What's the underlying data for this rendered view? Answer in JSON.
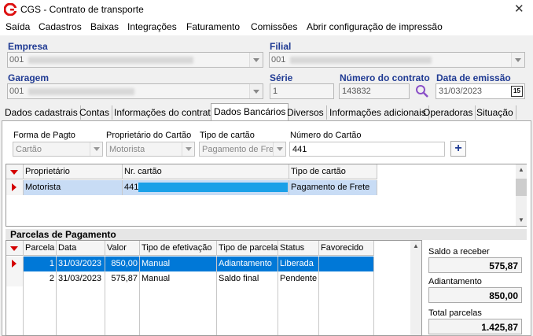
{
  "window": {
    "title": "CGS - Contrato de transporte",
    "close_label": "✕"
  },
  "menu": [
    "Saída",
    "Cadastros",
    "Baixas",
    "Integrações",
    "Faturamento",
    "Comissões",
    "Abrir configuração de impressão"
  ],
  "header": {
    "empresa_label": "Empresa",
    "empresa_value": "001",
    "filial_label": "Filial",
    "filial_value": "001",
    "garagem_label": "Garagem",
    "garagem_value": "001",
    "serie_label": "Série",
    "serie_value": "1",
    "numero_label": "Número do contrato",
    "numero_value": "143832",
    "data_label": "Data de emissão",
    "data_value": "31/03/2023",
    "calendar_label": "15"
  },
  "tabs": [
    "Dados cadastrais",
    "Contas",
    "Informações do contrato",
    "Dados Bancários",
    "Diversos",
    "Informações adicionais",
    "Operadoras",
    "Situação"
  ],
  "active_tab": "Dados Bancários",
  "bank": {
    "forma_label": "Forma de Pagto",
    "forma_value": "Cartão",
    "prop_label": "Proprietário do Cartão",
    "prop_value": "Motorista",
    "tipo_label": "Tipo de cartão",
    "tipo_value": "Pagamento de Fre",
    "num_label": "Número do Cartão",
    "num_value": "441",
    "add_label": "+"
  },
  "cards_grid": {
    "columns": [
      "Proprietário",
      "Nr. cartão",
      "Tipo de cartão"
    ],
    "rows": [
      {
        "prop": "Motorista",
        "nr": "441",
        "tipo": "Pagamento de Frete"
      }
    ]
  },
  "parcelas": {
    "title": "Parcelas de Pagamento",
    "columns": [
      "Parcela",
      "Data",
      "Valor",
      "Tipo de efetivação",
      "Tipo de parcela",
      "Status",
      "Favorecido"
    ],
    "rows": [
      {
        "parcela": "1",
        "data": "31/03/2023",
        "valor": "850,00",
        "efetivacao": "Manual",
        "tipo": "Adiantamento",
        "status": "Liberada",
        "favorecido": ""
      },
      {
        "parcela": "2",
        "data": "31/03/2023",
        "valor": "575,87",
        "efetivacao": "Manual",
        "tipo": "Saldo final",
        "status": "Pendente",
        "favorecido": ""
      }
    ]
  },
  "summary": {
    "saldo_label": "Saldo a receber",
    "saldo_value": "575,87",
    "adiant_label": "Adiantamento",
    "adiant_value": "850,00",
    "total_label": "Total parcelas",
    "total_value": "1.425,87"
  },
  "colors": {
    "accent": "#0078d7",
    "label_blue": "#1f3a93",
    "red_marker": "#d40000",
    "selected_row": "#c8dcf5"
  }
}
